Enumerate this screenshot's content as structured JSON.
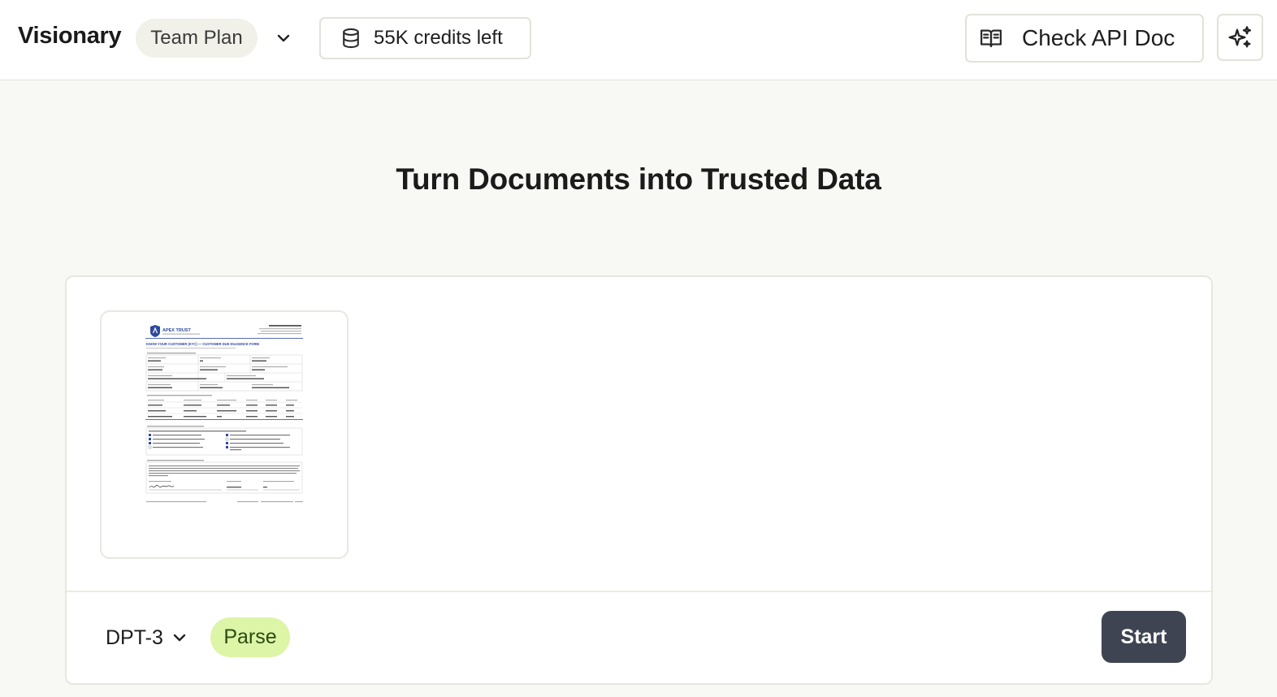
{
  "header": {
    "brand": "Visionary",
    "plan_label": "Team Plan",
    "plan_chevron_icon": "chevron-down-icon",
    "credits_label": "55K credits left",
    "credits_icon": "database-icon",
    "api_doc_label": "Check API Doc",
    "api_doc_icon": "open-book-icon",
    "assistant_icon": "sparkles-icon"
  },
  "main": {
    "headline": "Turn Documents into Trusted Data"
  },
  "upload_card": {
    "thumbnail": {
      "logo_text": "APEX TRUST",
      "form_title": "KNOW YOUR CUSTOMER (KYC) — CUSTOMER DUE DILIGENCE FORM"
    },
    "model_label": "DPT-3",
    "model_chevron_icon": "chevron-down-icon",
    "mode_label": "Parse",
    "start_label": "Start"
  },
  "colors": {
    "page_bg": "#f8f8f5",
    "border": "#e4e3dc",
    "plan_pill_bg": "#f1f1ea",
    "mode_pill_bg": "#dcf5a7",
    "start_bg": "#3e4452",
    "doc_accent": "#2e4a9e"
  }
}
